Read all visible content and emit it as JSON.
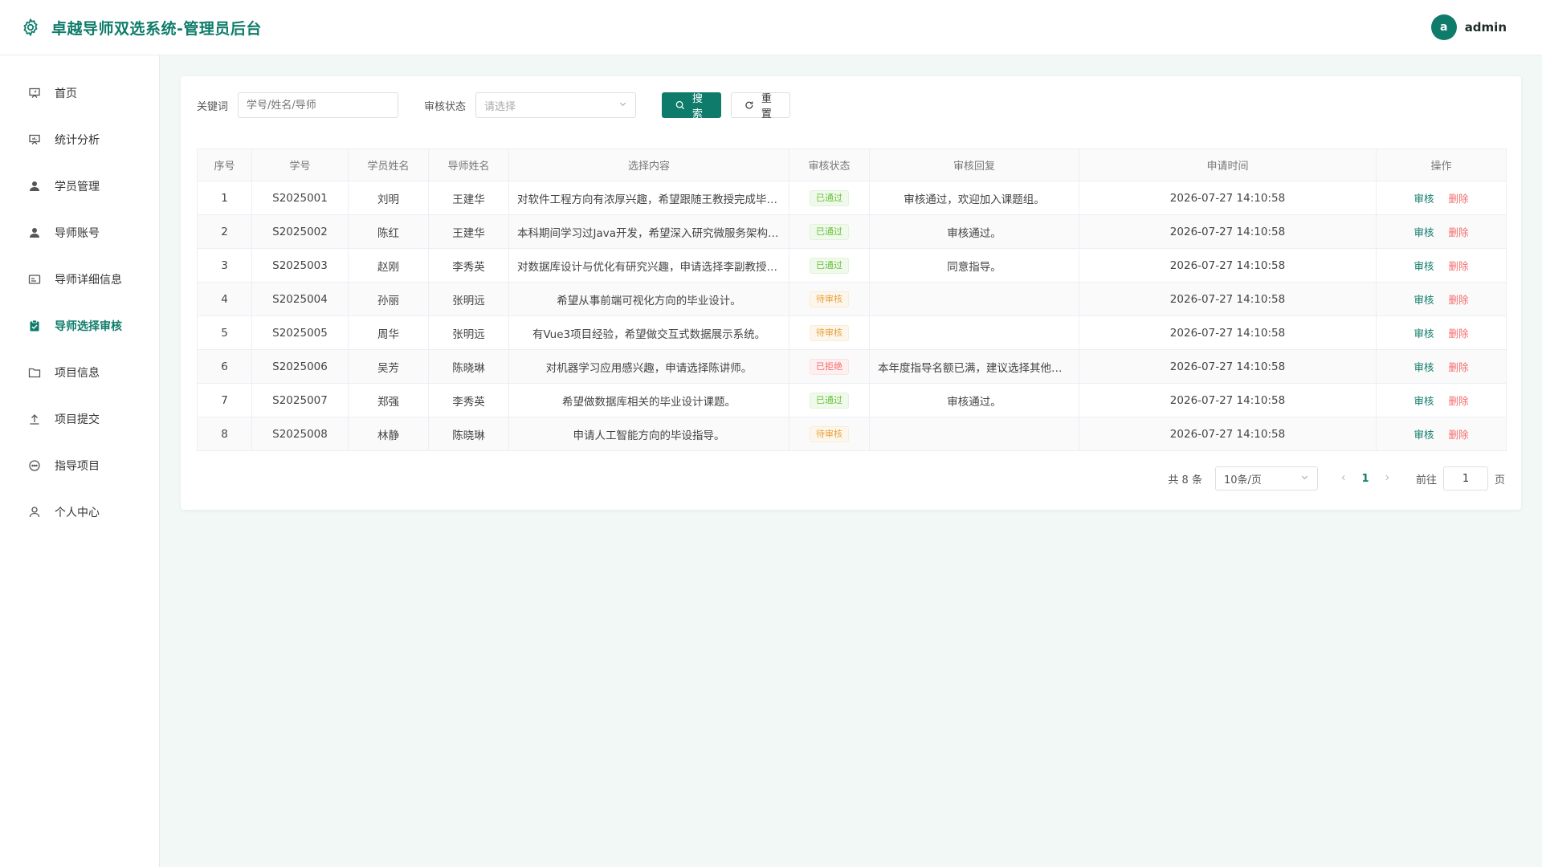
{
  "header": {
    "title": "卓越导师双选系统-管理员后台",
    "logo_icon": "gear-icon",
    "avatar_letter": "a",
    "username": "admin"
  },
  "colors": {
    "brand": "#0f7c6b",
    "pass": "#67c23a",
    "wait": "#e6a23c",
    "reject": "#f56c6c"
  },
  "sidebar": {
    "items": [
      {
        "label": "首页",
        "icon": "presentation-icon",
        "active": false
      },
      {
        "label": "统计分析",
        "icon": "presentation-icon",
        "active": false
      },
      {
        "label": "学员管理",
        "icon": "user-icon",
        "active": false
      },
      {
        "label": "导师账号",
        "icon": "user-icon",
        "active": false
      },
      {
        "label": "导师详细信息",
        "icon": "id-card-icon",
        "active": false
      },
      {
        "label": "导师选择审核",
        "icon": "clipboard-check-icon",
        "active": true
      },
      {
        "label": "项目信息",
        "icon": "folder-icon",
        "active": false
      },
      {
        "label": "项目提交",
        "icon": "upload-icon",
        "active": false
      },
      {
        "label": "指导项目",
        "icon": "chat-icon",
        "active": false
      },
      {
        "label": "个人中心",
        "icon": "user-outline-icon",
        "active": false
      }
    ]
  },
  "filters": {
    "keyword_label": "关键词",
    "keyword_placeholder": "学号/姓名/导师",
    "status_label": "审核状态",
    "status_placeholder": "请选择",
    "search_button": "搜索",
    "reset_button": "重置"
  },
  "table": {
    "columns": [
      "序号",
      "学号",
      "学员姓名",
      "导师姓名",
      "选择内容",
      "审核状态",
      "审核回复",
      "申请时间",
      "操作"
    ],
    "audit_label": "审核",
    "delete_label": "删除",
    "rows": [
      {
        "no": "1",
        "sid": "S2025001",
        "student": "刘明",
        "mentor": "王建华",
        "content": "对软件工程方向有浓厚兴趣，希望跟随王教授完成毕业设计研究工作。",
        "status": "已通过",
        "status_type": "pass",
        "reply": "审核通过，欢迎加入课题组。",
        "time": "2026-07-27 14:10:58"
      },
      {
        "no": "2",
        "sid": "S2025002",
        "student": "陈红",
        "mentor": "王建华",
        "content": "本科期间学习过Java开发，希望深入研究微服务架构相关课题。",
        "status": "已通过",
        "status_type": "pass",
        "reply": "审核通过。",
        "time": "2026-07-27 14:10:58"
      },
      {
        "no": "3",
        "sid": "S2025003",
        "student": "赵刚",
        "mentor": "李秀英",
        "content": "对数据库设计与优化有研究兴趣，申请选择李副教授作为导师。",
        "status": "已通过",
        "status_type": "pass",
        "reply": "同意指导。",
        "time": "2026-07-27 14:10:58"
      },
      {
        "no": "4",
        "sid": "S2025004",
        "student": "孙丽",
        "mentor": "张明远",
        "content": "希望从事前端可视化方向的毕业设计。",
        "status": "待审核",
        "status_type": "wait",
        "reply": "",
        "time": "2026-07-27 14:10:58"
      },
      {
        "no": "5",
        "sid": "S2025005",
        "student": "周华",
        "mentor": "张明远",
        "content": "有Vue3项目经验，希望做交互式数据展示系统。",
        "status": "待审核",
        "status_type": "wait",
        "reply": "",
        "time": "2026-07-27 14:10:58"
      },
      {
        "no": "6",
        "sid": "S2025006",
        "student": "吴芳",
        "mentor": "陈晓琳",
        "content": "对机器学习应用感兴趣，申请选择陈讲师。",
        "status": "已拒绝",
        "status_type": "reject",
        "reply": "本年度指导名额已满，建议选择其他导师。",
        "time": "2026-07-27 14:10:58"
      },
      {
        "no": "7",
        "sid": "S2025007",
        "student": "郑强",
        "mentor": "李秀英",
        "content": "希望做数据库相关的毕业设计课题。",
        "status": "已通过",
        "status_type": "pass",
        "reply": "审核通过。",
        "time": "2026-07-27 14:10:58"
      },
      {
        "no": "8",
        "sid": "S2025008",
        "student": "林静",
        "mentor": "陈晓琳",
        "content": "申请人工智能方向的毕设指导。",
        "status": "待审核",
        "status_type": "wait",
        "reply": "",
        "time": "2026-07-27 14:10:58"
      }
    ]
  },
  "pagination": {
    "total_text": "共 8 条",
    "page_size": "10条/页",
    "current_page": "1",
    "goto_label": "前往",
    "goto_value": "1",
    "page_unit": "页"
  }
}
